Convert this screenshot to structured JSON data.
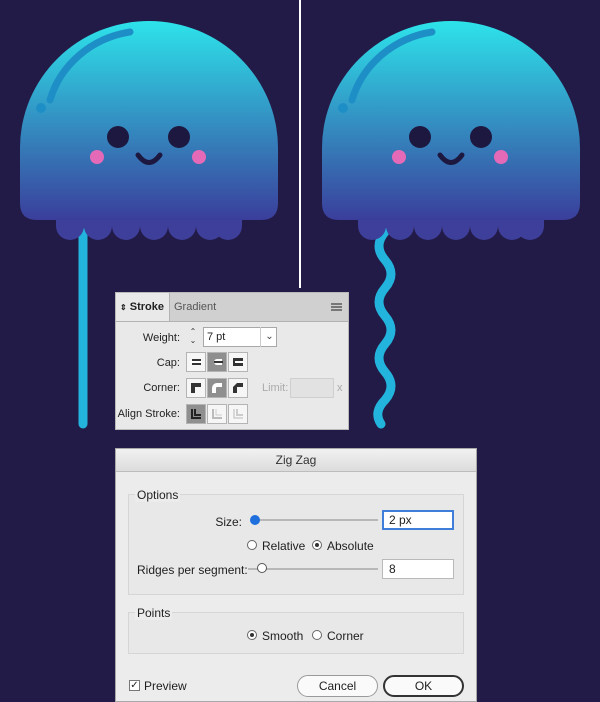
{
  "colors": {
    "background": "#231b47",
    "bell_top": "#2de3ea",
    "bell_bottom": "#3a3e9b",
    "tentacle": "#22b4dc",
    "cheek": "#e46ab8",
    "face": "#1d1840",
    "accent": "#1f6fdc"
  },
  "stroke_panel": {
    "tab_stroke": "Stroke",
    "tab_gradient": "Gradient",
    "weight_label": "Weight:",
    "weight_value": "7 pt",
    "cap_label": "Cap:",
    "corner_label": "Corner:",
    "limit_label": "Limit:",
    "limit_unit": "x",
    "align_label": "Align Stroke:"
  },
  "zigzag_dialog": {
    "title": "Zig Zag",
    "options_label": "Options",
    "size_label": "Size:",
    "size_value": "2 px",
    "relative_label": "Relative",
    "absolute_label": "Absolute",
    "ridges_label": "Ridges per segment:",
    "ridges_value": "8",
    "points_label": "Points",
    "smooth_label": "Smooth",
    "corner_label": "Corner",
    "preview_label": "Preview",
    "cancel_label": "Cancel",
    "ok_label": "OK"
  }
}
